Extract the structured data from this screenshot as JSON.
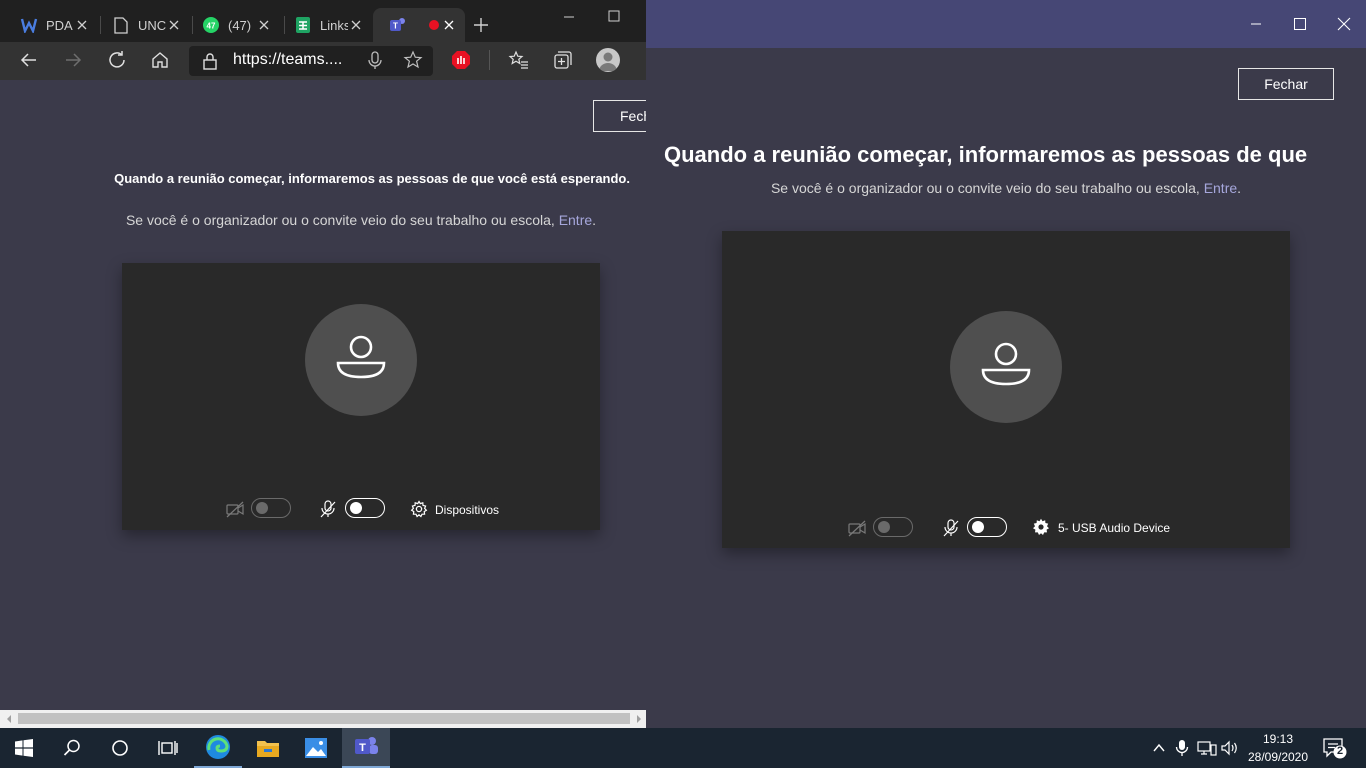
{
  "browser": {
    "tabs": [
      {
        "label": "PDA",
        "icon": "unknown-site-icon"
      },
      {
        "label": "UNC",
        "icon": "page-icon"
      },
      {
        "label": "(47)",
        "icon": "whatsapp-icon",
        "badge": "47"
      },
      {
        "label": "Links",
        "icon": "sheets-icon"
      },
      {
        "label": "",
        "icon": "teams-icon",
        "recording": true
      }
    ],
    "url": "https://teams....",
    "page": {
      "close_button": "Fech",
      "heading": "Quando a reunião começar, informaremos as pessoas de que você está esperando.",
      "subtext": "Se você é o organizador ou o convite veio do seu trabalho ou escola,",
      "link": "Entre",
      "link_suffix": ".",
      "devices_label": "Dispositivos"
    }
  },
  "teams": {
    "close_button": "Fechar",
    "heading": "Quando a reunião começar, informaremos as pessoas de que",
    "subtext": "Se você é o organizador ou o convite veio do seu trabalho ou escola,",
    "link": "Entre",
    "link_suffix": ".",
    "device_label": "5- USB Audio Device"
  },
  "taskbar": {
    "time": "19:13",
    "date": "28/09/2020",
    "notification_count": "2"
  },
  "colors": {
    "page_bg": "#3b3a4a",
    "teams_titlebar": "#464775",
    "link": "#a6a7dc",
    "taskbar": "#1a2531"
  }
}
